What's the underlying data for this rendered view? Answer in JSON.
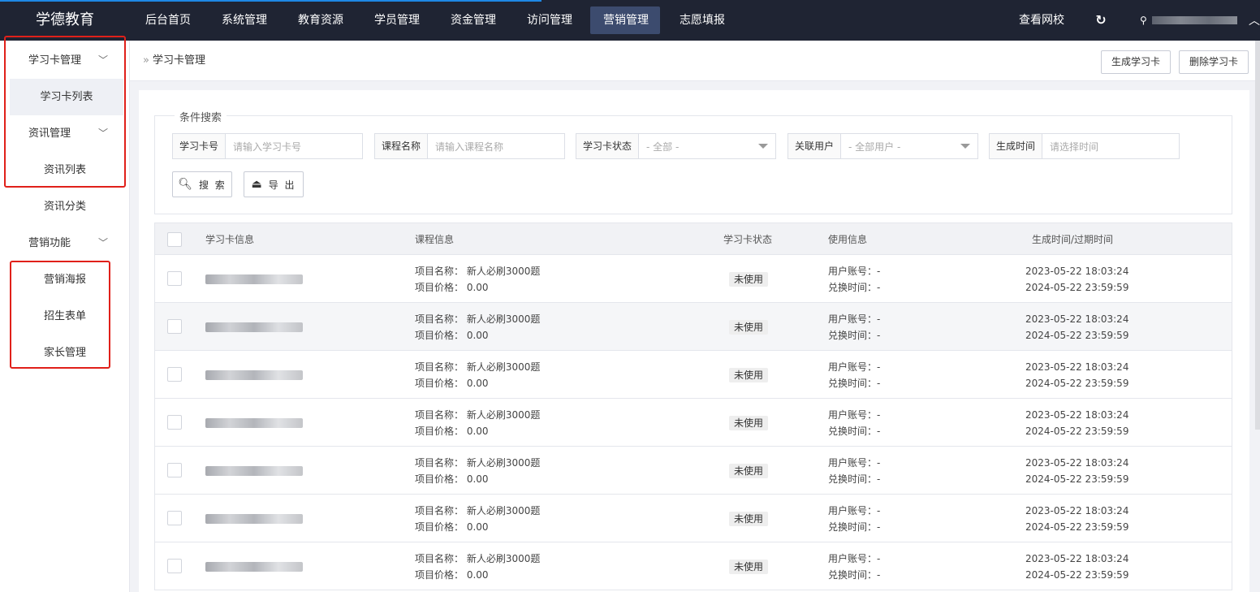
{
  "brand": "学德教育",
  "nav": [
    "后台首页",
    "系统管理",
    "教育资源",
    "学员管理",
    "资金管理",
    "访问管理",
    "营销管理",
    "志愿填报"
  ],
  "nav_active_index": 6,
  "topright": {
    "view_site": "查看网校",
    "refresh_icon": "↻"
  },
  "sidebar": {
    "groups": [
      {
        "label": "学习卡管理",
        "items": [
          "学习卡列表"
        ]
      },
      {
        "label": "资讯管理",
        "items": [
          "资讯列表",
          "资讯分类"
        ]
      },
      {
        "label": "营销功能",
        "items": [
          "营销海报",
          "招生表单",
          "家长管理"
        ]
      }
    ],
    "active_item": "学习卡列表"
  },
  "breadcrumb": "学习卡管理",
  "actions": {
    "generate": "生成学习卡",
    "delete": "删除学习卡"
  },
  "search": {
    "legend": "条件搜索",
    "card_no": {
      "label": "学习卡号",
      "placeholder": "请输入学习卡号"
    },
    "course": {
      "label": "课程名称",
      "placeholder": "请输入课程名称"
    },
    "status": {
      "label": "学习卡状态",
      "value": "- 全部 -"
    },
    "user": {
      "label": "关联用户",
      "value": "- 全部用户 -"
    },
    "time": {
      "label": "生成时间",
      "placeholder": "请选择时间"
    },
    "search_btn": "搜 索",
    "export_btn": "导 出"
  },
  "table": {
    "headers": [
      "学习卡信息",
      "课程信息",
      "学习卡状态",
      "使用信息",
      "生成时间/过期时间"
    ],
    "rows": [
      {
        "name_label": "项目名称：",
        "name": "新人必刷3000题",
        "price_label": "项目价格：",
        "price": "0.00",
        "status": "未使用",
        "acct_label": "用户账号：",
        "acct": "-",
        "redeem_label": "兑换时间：",
        "redeem": "-",
        "created": "2023-05-22 18:03:24",
        "expires": "2024-05-22 23:59:59"
      },
      {
        "name_label": "项目名称：",
        "name": "新人必刷3000题",
        "price_label": "项目价格：",
        "price": "0.00",
        "status": "未使用",
        "acct_label": "用户账号：",
        "acct": "-",
        "redeem_label": "兑换时间：",
        "redeem": "-",
        "created": "2023-05-22 18:03:24",
        "expires": "2024-05-22 23:59:59"
      },
      {
        "name_label": "项目名称：",
        "name": "新人必刷3000题",
        "price_label": "项目价格：",
        "price": "0.00",
        "status": "未使用",
        "acct_label": "用户账号：",
        "acct": "-",
        "redeem_label": "兑换时间：",
        "redeem": "-",
        "created": "2023-05-22 18:03:24",
        "expires": "2024-05-22 23:59:59"
      },
      {
        "name_label": "项目名称：",
        "name": "新人必刷3000题",
        "price_label": "项目价格：",
        "price": "0.00",
        "status": "未使用",
        "acct_label": "用户账号：",
        "acct": "-",
        "redeem_label": "兑换时间：",
        "redeem": "-",
        "created": "2023-05-22 18:03:24",
        "expires": "2024-05-22 23:59:59"
      },
      {
        "name_label": "项目名称：",
        "name": "新人必刷3000题",
        "price_label": "项目价格：",
        "price": "0.00",
        "status": "未使用",
        "acct_label": "用户账号：",
        "acct": "-",
        "redeem_label": "兑换时间：",
        "redeem": "-",
        "created": "2023-05-22 18:03:24",
        "expires": "2024-05-22 23:59:59"
      },
      {
        "name_label": "项目名称：",
        "name": "新人必刷3000题",
        "price_label": "项目价格：",
        "price": "0.00",
        "status": "未使用",
        "acct_label": "用户账号：",
        "acct": "-",
        "redeem_label": "兑换时间：",
        "redeem": "-",
        "created": "2023-05-22 18:03:24",
        "expires": "2024-05-22 23:59:59"
      },
      {
        "name_label": "项目名称：",
        "name": "新人必刷3000题",
        "price_label": "项目价格：",
        "price": "0.00",
        "status": "未使用",
        "acct_label": "用户账号：",
        "acct": "-",
        "redeem_label": "兑换时间：",
        "redeem": "-",
        "created": "2023-05-22 18:03:24",
        "expires": "2024-05-22 23:59:59"
      }
    ]
  },
  "colors": {
    "topbar": "#1f2433",
    "active_nav": "#3c4b6e",
    "highlight_box": "#e0201a"
  }
}
